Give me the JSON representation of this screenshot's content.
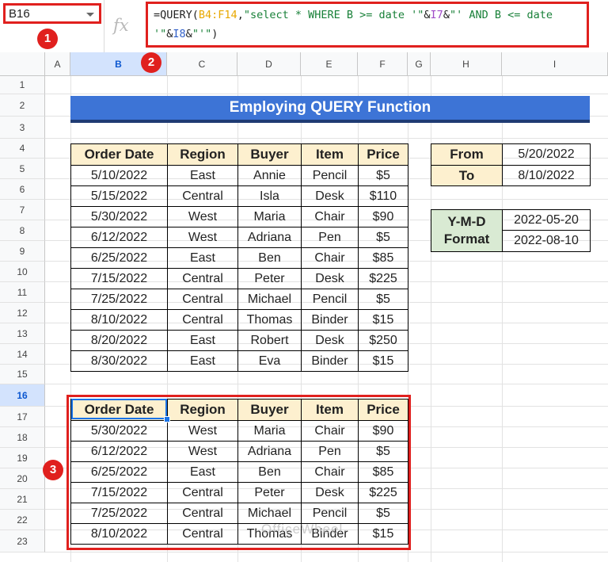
{
  "toolbar": {
    "name_box": "B16",
    "fx_label": "fx",
    "formula": {
      "p1": "=QUERY(",
      "r1": "B4:F14",
      "p2": ",",
      "s1": "\"select * WHERE B >= date '\"",
      "p3": "&",
      "r2": "I7",
      "p4": "&",
      "s2": "\"' AND B <= date",
      "line2_s": "'\"",
      "line2_p1": "&",
      "line2_r": "I8",
      "line2_p2": "&",
      "line2_s2": "\"'\"",
      "line2_p3": ")"
    }
  },
  "badges": [
    "1",
    "2",
    "3"
  ],
  "columns": [
    "A",
    "B",
    "C",
    "D",
    "E",
    "F",
    "G",
    "H",
    "I"
  ],
  "rows": [
    "1",
    "2",
    "3",
    "4",
    "5",
    "6",
    "7",
    "8",
    "9",
    "10",
    "11",
    "12",
    "13",
    "14",
    "15",
    "16",
    "17",
    "18",
    "19",
    "20",
    "21",
    "22",
    "23"
  ],
  "title": "Employing QUERY Function",
  "source_table": {
    "headers": [
      "Order Date",
      "Region",
      "Buyer",
      "Item",
      "Price"
    ],
    "rows": [
      [
        "5/10/2022",
        "East",
        "Annie",
        "Pencil",
        "$5"
      ],
      [
        "5/15/2022",
        "Central",
        "Isla",
        "Desk",
        "$110"
      ],
      [
        "5/30/2022",
        "West",
        "Maria",
        "Chair",
        "$90"
      ],
      [
        "6/12/2022",
        "West",
        "Adriana",
        "Pen",
        "$5"
      ],
      [
        "6/25/2022",
        "East",
        "Ben",
        "Chair",
        "$85"
      ],
      [
        "7/15/2022",
        "Central",
        "Peter",
        "Desk",
        "$225"
      ],
      [
        "7/25/2022",
        "Central",
        "Michael",
        "Pencil",
        "$5"
      ],
      [
        "8/10/2022",
        "Central",
        "Thomas",
        "Binder",
        "$15"
      ],
      [
        "8/20/2022",
        "East",
        "Robert",
        "Desk",
        "$250"
      ],
      [
        "8/30/2022",
        "East",
        "Eva",
        "Binder",
        "$15"
      ]
    ]
  },
  "range_table": {
    "from_label": "From",
    "from_value": "5/20/2022",
    "to_label": "To",
    "to_value": "8/10/2022"
  },
  "ymd_table": {
    "label": "Y-M-D Format",
    "value1": "2022-05-20",
    "value2": "2022-08-10"
  },
  "result_table": {
    "headers": [
      "Order Date",
      "Region",
      "Buyer",
      "Item",
      "Price"
    ],
    "rows": [
      [
        "5/30/2022",
        "West",
        "Maria",
        "Chair",
        "$90"
      ],
      [
        "6/12/2022",
        "West",
        "Adriana",
        "Pen",
        "$5"
      ],
      [
        "6/25/2022",
        "East",
        "Ben",
        "Chair",
        "$85"
      ],
      [
        "7/15/2022",
        "Central",
        "Peter",
        "Desk",
        "$225"
      ],
      [
        "7/25/2022",
        "Central",
        "Michael",
        "Pencil",
        "$5"
      ],
      [
        "8/10/2022",
        "Central",
        "Thomas",
        "Binder",
        "$15"
      ]
    ]
  },
  "watermark": "OfficeWheel",
  "colors": {
    "accent": "#e0201e",
    "title_bg": "#3d74d6",
    "header_bg": "#fdf0cf",
    "label_bg": "#d9ead3"
  }
}
